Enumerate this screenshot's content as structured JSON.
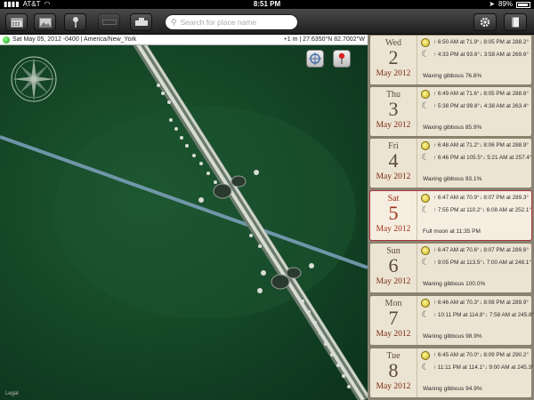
{
  "status_bar": {
    "carrier": "AT&T",
    "time": "8:51 PM",
    "battery": "89%"
  },
  "search": {
    "placeholder": "Search for place name"
  },
  "map": {
    "date_info": "Sat May 05, 2012 -0400 | America/New_York",
    "coords_info": "+1 m | 27.6350°N 82.7002°W",
    "legal": "Legal"
  },
  "days": [
    {
      "dow": "Wed",
      "num": "2",
      "month": "May 2012",
      "selected": false,
      "sun": "↑ 6:50 AM at 71.9°↓ 8:05 PM at 288.2°",
      "moon": "↑ 4:33 PM at 93.6°↓ 3:58 AM at 269.6°",
      "phase": "Waxing gibbous 76.8%"
    },
    {
      "dow": "Thu",
      "num": "3",
      "month": "May 2012",
      "selected": false,
      "sun": "↑ 6:49 AM at 71.6°↓ 8:05 PM at 288.6°",
      "moon": "↑ 5:38 PM at 99.8°↓ 4:38 AM at 263.4°",
      "phase": "Waxing gibbous 85.9%"
    },
    {
      "dow": "Fri",
      "num": "4",
      "month": "May 2012",
      "selected": false,
      "sun": "↑ 6:48 AM at 71.2°↓ 8:06 PM at 288.9°",
      "moon": "↑ 6:46 PM at 105.5°↓ 5:21 AM at 257.4°",
      "phase": "Waxing gibbous 93.1%"
    },
    {
      "dow": "Sat",
      "num": "5",
      "month": "May 2012",
      "selected": true,
      "sun": "↑ 6:47 AM at 70.9°↓ 8:07 PM at 289.3°",
      "moon": "↑ 7:55 PM at 110.2°↓ 6:08 AM at 252.1°",
      "phase": "Full moon at 11:35 PM"
    },
    {
      "dow": "Sun",
      "num": "6",
      "month": "May 2012",
      "selected": false,
      "sun": "↑ 6:47 AM at 70.6°↓ 8:07 PM at 289.6°",
      "moon": "↑ 9:05 PM at 113.5°↓ 7:00 AM at 248.1°",
      "phase": "Waning gibbous 100.0%"
    },
    {
      "dow": "Mon",
      "num": "7",
      "month": "May 2012",
      "selected": false,
      "sun": "↑ 6:46 AM at 70.3°↓ 8:08 PM at 289.9°",
      "moon": "↑ 10:11 PM at 114.8°↓ 7:58 AM at 245.8°",
      "phase": "Waning gibbous 98.9%"
    },
    {
      "dow": "Tue",
      "num": "8",
      "month": "May 2012",
      "selected": false,
      "sun": "↑ 6:45 AM at 70.0°↓ 8:09 PM at 290.2°",
      "moon": "↑ 11:11 PM at 114.1°↓ 9:00 AM at 245.3°",
      "phase": "Waning gibbous 94.9%"
    }
  ]
}
